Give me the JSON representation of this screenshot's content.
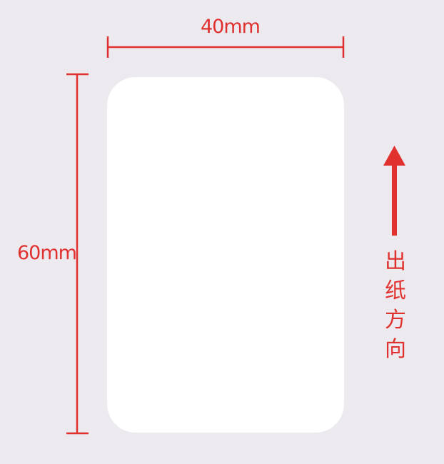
{
  "dimensions": {
    "width_label": "40mm",
    "height_label": "60mm"
  },
  "feed_direction": {
    "text": "出纸方向"
  },
  "colors": {
    "background": "#ece9ef",
    "card": "#ffffff",
    "accent": "#e0312e"
  }
}
